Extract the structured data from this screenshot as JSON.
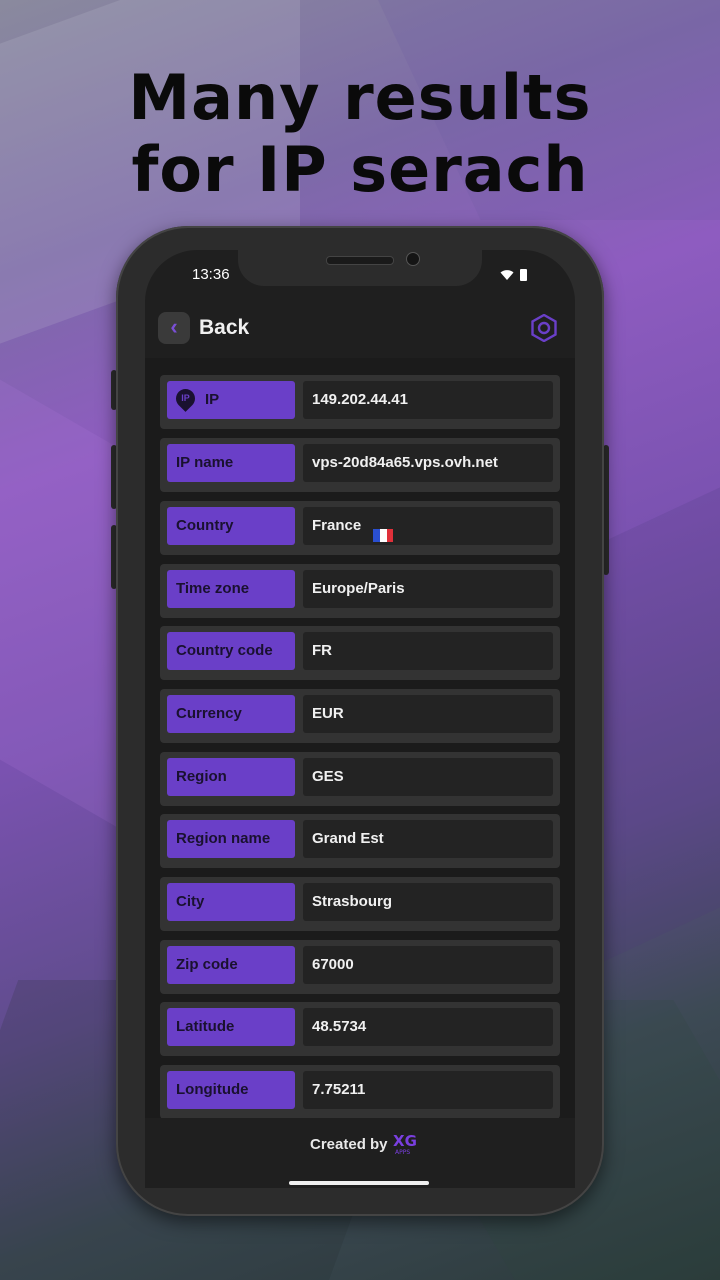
{
  "headline": {
    "line1": "Many results",
    "line2": "for IP serach"
  },
  "status": {
    "time": "13:36"
  },
  "appbar": {
    "back_label": "Back"
  },
  "rows": [
    {
      "label": "IP",
      "value": "149.202.44.41"
    },
    {
      "label": "IP name",
      "value": "vps-20d84a65.vps.ovh.net"
    },
    {
      "label": "Country",
      "value": "France"
    },
    {
      "label": "Time zone",
      "value": "Europe/Paris"
    },
    {
      "label": "Country code",
      "value": "FR"
    },
    {
      "label": "Currency",
      "value": "EUR"
    },
    {
      "label": "Region",
      "value": "GES"
    },
    {
      "label": "Region name",
      "value": "Grand Est"
    },
    {
      "label": "City",
      "value": "Strasbourg"
    },
    {
      "label": "Zip code",
      "value": "67000"
    },
    {
      "label": "Latitude",
      "value": "48.5734"
    },
    {
      "label": "Longitude",
      "value": "7.75211"
    }
  ],
  "footer": {
    "created_by": "Created by",
    "logo_text": "XG",
    "logo_sub": "APPS"
  },
  "colors": {
    "accent": "#6a3fc8",
    "background": "#1f1f1f"
  },
  "icons": {
    "back": "chevron-left-icon",
    "settings": "hexagon-settings-icon",
    "ip": "location-pin-icon",
    "flag": "france-flag-icon"
  }
}
